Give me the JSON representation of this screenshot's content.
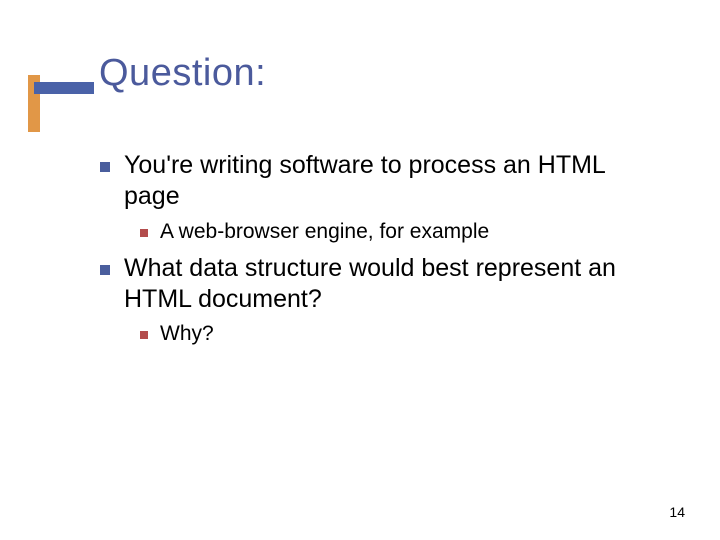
{
  "title": "Question:",
  "bullets": {
    "b0": "You're writing software to process an HTML page",
    "b0_sub0": "A web-browser engine, for example",
    "b1": "What data structure would best represent an HTML document?",
    "b1_sub0": "Why?"
  },
  "page_number": "14"
}
